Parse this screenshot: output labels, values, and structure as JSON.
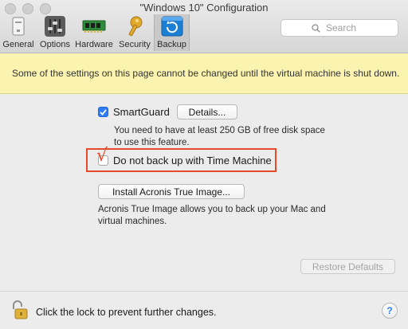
{
  "window": {
    "title": "\"Windows 10\" Configuration"
  },
  "toolbar": {
    "items": [
      {
        "label": "General",
        "icon": "general-icon",
        "selected": false
      },
      {
        "label": "Options",
        "icon": "options-sliders-icon",
        "selected": false
      },
      {
        "label": "Hardware",
        "icon": "hardware-chip-icon",
        "selected": false
      },
      {
        "label": "Security",
        "icon": "key-icon",
        "selected": false
      },
      {
        "label": "Backup",
        "icon": "backup-icon",
        "selected": true
      }
    ],
    "search_placeholder": "Search"
  },
  "banner": {
    "text": "Some of the settings on this page cannot be changed until the virtual machine is shut down.",
    "color": "#fbf4b0"
  },
  "backup": {
    "smartguard": {
      "label": "SmartGuard",
      "checked": true,
      "details_button": "Details...",
      "description_line1": "You need to have at least 250 GB of free disk space",
      "description_line2": "to use this feature."
    },
    "time_machine": {
      "label": "Do not back up with Time Machine",
      "checked": false,
      "annotation_mark": "√",
      "highlight_color": "#e34b2a"
    },
    "acronis": {
      "button": "Install Acronis True Image...",
      "description_line1": "Acronis True Image allows you to back up your Mac and",
      "description_line2": "virtual machines."
    },
    "restore_defaults": "Restore Defaults"
  },
  "footer": {
    "lock_text": "Click the lock to prevent further changes.",
    "help": "?"
  },
  "colors": {
    "accent": "#2e7cf6",
    "annotation": "#e34b2a"
  }
}
